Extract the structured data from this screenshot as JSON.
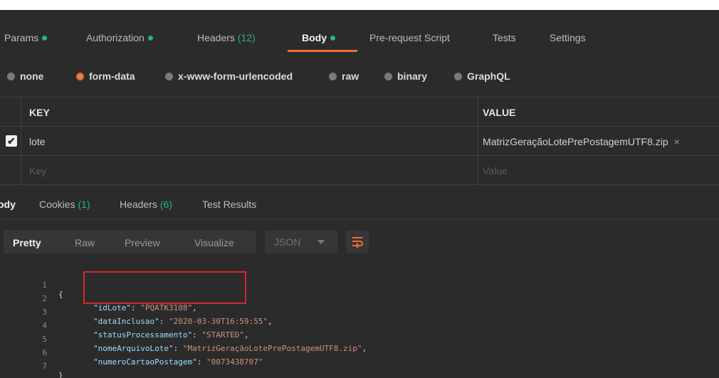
{
  "request_tabs": [
    {
      "label": "Params",
      "dot": true,
      "count": ""
    },
    {
      "label": "Authorization",
      "dot": true,
      "count": ""
    },
    {
      "label": "Headers",
      "dot": false,
      "count": "(12)"
    },
    {
      "label": "Body",
      "dot": true,
      "count": "",
      "active": true
    },
    {
      "label": "Pre-request Script",
      "dot": false,
      "count": ""
    },
    {
      "label": "Tests",
      "dot": false,
      "count": ""
    },
    {
      "label": "Settings",
      "dot": false,
      "count": ""
    }
  ],
  "body_types": [
    {
      "label": "none",
      "selected": false
    },
    {
      "label": "form-data",
      "selected": true
    },
    {
      "label": "x-www-form-urlencoded",
      "selected": false
    },
    {
      "label": "raw",
      "selected": false
    },
    {
      "label": "binary",
      "selected": false
    },
    {
      "label": "GraphQL",
      "selected": false
    }
  ],
  "form_table": {
    "key_header": "KEY",
    "value_header": "VALUE",
    "rows": [
      {
        "checked": true,
        "key": "lote",
        "value": "MatrizGeraçãoLotePrePostagemUTF8.zip",
        "remove_icon": "×"
      }
    ],
    "new_row": {
      "key_placeholder": "Key",
      "value_placeholder": "Value"
    }
  },
  "response_tabs": [
    {
      "label": "ody",
      "count": "",
      "active": true
    },
    {
      "label": "Cookies",
      "count": "(1)"
    },
    {
      "label": "Headers",
      "count": "(6)"
    },
    {
      "label": "Test Results",
      "count": ""
    }
  ],
  "view_modes": [
    {
      "label": "Pretty",
      "active": true
    },
    {
      "label": "Raw",
      "active": false
    },
    {
      "label": "Preview",
      "active": false
    },
    {
      "label": "Visualize",
      "active": false
    }
  ],
  "format_select": "JSON",
  "code": {
    "line_numbers": [
      "1",
      "2",
      "3",
      "4",
      "5",
      "6",
      "7"
    ],
    "open_brace": "{",
    "close_brace": "}",
    "fields": [
      {
        "key": "\"idLote\"",
        "value": "\"PQATK3108\"",
        "comma": ","
      },
      {
        "key": "\"dataInclusao\"",
        "value": "\"2020-03-30T16:59:55\"",
        "comma": ","
      },
      {
        "key": "\"statusProcessamento\"",
        "value": "\"STARTED\"",
        "comma": ","
      },
      {
        "key": "\"nomeArquivoLote\"",
        "value": "\"MatrizGeraçãoLotePrePostagemUTF8.zip\"",
        "comma": ","
      },
      {
        "key": "\"numeroCartaoPostagem\"",
        "value": "\"0073438707\"",
        "comma": ""
      }
    ]
  },
  "colors": {
    "accent": "#f26b3a",
    "status_dot": "#26b47f",
    "highlight_box": "#d8262b",
    "background": "#2b2b2b"
  }
}
